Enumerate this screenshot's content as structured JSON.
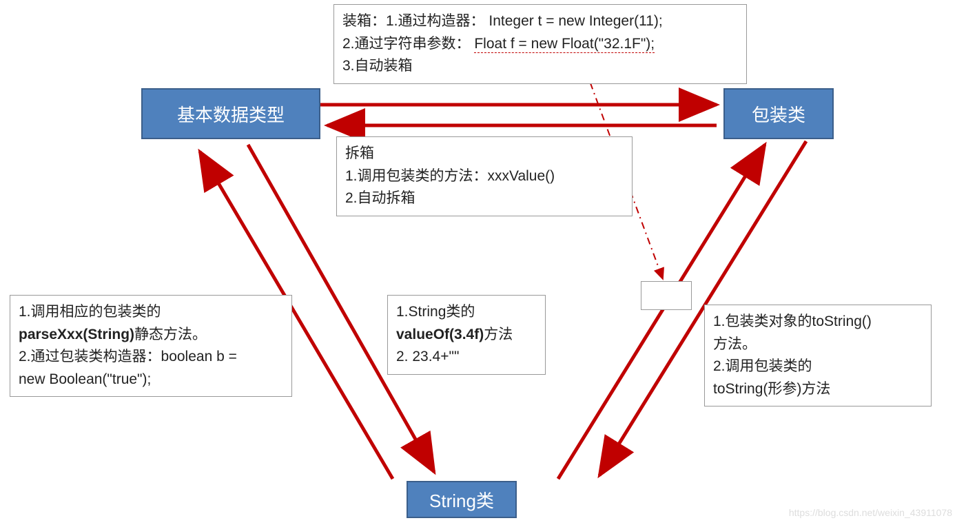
{
  "nodes": {
    "primitive": "基本数据类型",
    "wrapper": "包装类",
    "string": "String类"
  },
  "boxing": {
    "line1a": "装箱：1.通过构造器：",
    "line1b": "Integer t = new Integer(11);",
    "line2a": "2.通过字符串参数：",
    "line2b": "Float f = new Float(\"32.1F\");",
    "line3": "3.自动装箱"
  },
  "unboxing": {
    "line1": "拆箱",
    "line2": "1.调用包装类的方法：xxxValue()",
    "line3": "2.自动拆箱"
  },
  "parse": {
    "line1a": "1.调用相应的包装类的",
    "line1b_bold": "parseXxx(String)",
    "line1c": "静态方法。",
    "line2a": "2.通过包装类构造器：boolean b =",
    "line2b": "new Boolean(\"true\");"
  },
  "valueof": {
    "line1": "1.String类的",
    "line2_bold": "valueOf(3.4f)",
    "line2_rest": "方法",
    "line3": "2. 23.4+\"\""
  },
  "tostring": {
    "line1": "1.包装类对象的toString()",
    "line2": "方法。",
    "line3": "2.调用包装类的",
    "line4": "toString(形参)方法"
  },
  "watermark": "https://blog.csdn.net/weixin_43911078"
}
